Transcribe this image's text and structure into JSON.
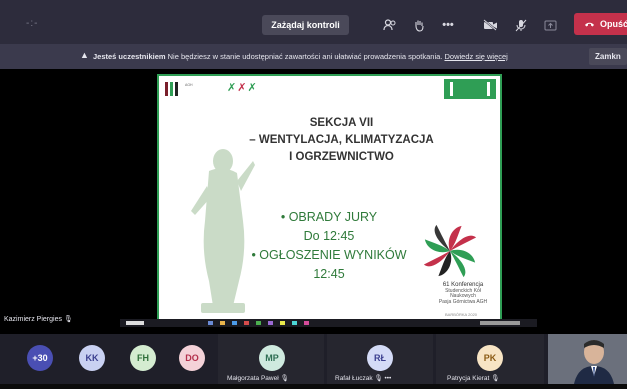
{
  "toolbar": {
    "control_button": "Zażądaj kontroli",
    "leave_button": "Opuść",
    "icons": [
      "participants-icon",
      "raise-hand-icon",
      "more-icon",
      "camera-off-icon",
      "mic-off-icon",
      "share-icon",
      "leave-phone-icon"
    ]
  },
  "banner": {
    "bold": "Jesteś uczestnikiem",
    "text": "Nie będziesz w stanie udostępniać zawartości ani ułatwiać prowadzenia spotkania.",
    "link": "Dowiedz się więcej",
    "close": "Zamkn"
  },
  "slide": {
    "title_lines": [
      "SEKCJA VII",
      "– WENTYLACJA, KLIMATYZACJA",
      "I OGRZEWNICTWO"
    ],
    "agenda": [
      "• OBRADY JURY",
      "Do 12:45",
      "• OGŁOSZENIE WYNIKÓW",
      "12:45"
    ],
    "conference_lines": [
      "61 Konferencja",
      "Studenckich Kół Naukowych",
      "Pasja Górnictwa AGH"
    ],
    "footer": "BARBÓRKA 2020",
    "logo1_text": "AGH"
  },
  "presenter_name": "Kazimierz Piergies",
  "participants": [
    {
      "initials": "+30",
      "color": "#4a4fb3",
      "text_color": "#ffffff"
    },
    {
      "initials": "KK",
      "color": "#c9d1f2",
      "text_color": "#3b3f8f"
    },
    {
      "initials": "FH",
      "color": "#d4ecd0",
      "text_color": "#2f6f3a"
    },
    {
      "initials": "DO",
      "color": "#f4d2d8",
      "text_color": "#b3304c"
    },
    {
      "initials": "MP",
      "color": "#cfeadf",
      "text_color": "#2f6f54",
      "name": "Małgorzata Paweł"
    },
    {
      "initials": "RŁ",
      "color": "#d4dbf7",
      "text_color": "#3b3f8f",
      "name": "Rafał Łuczak"
    },
    {
      "initials": "PK",
      "color": "#f7e4c4",
      "text_color": "#8a5a14",
      "name": "Patrycja Kierat"
    }
  ],
  "more_options": "•••"
}
